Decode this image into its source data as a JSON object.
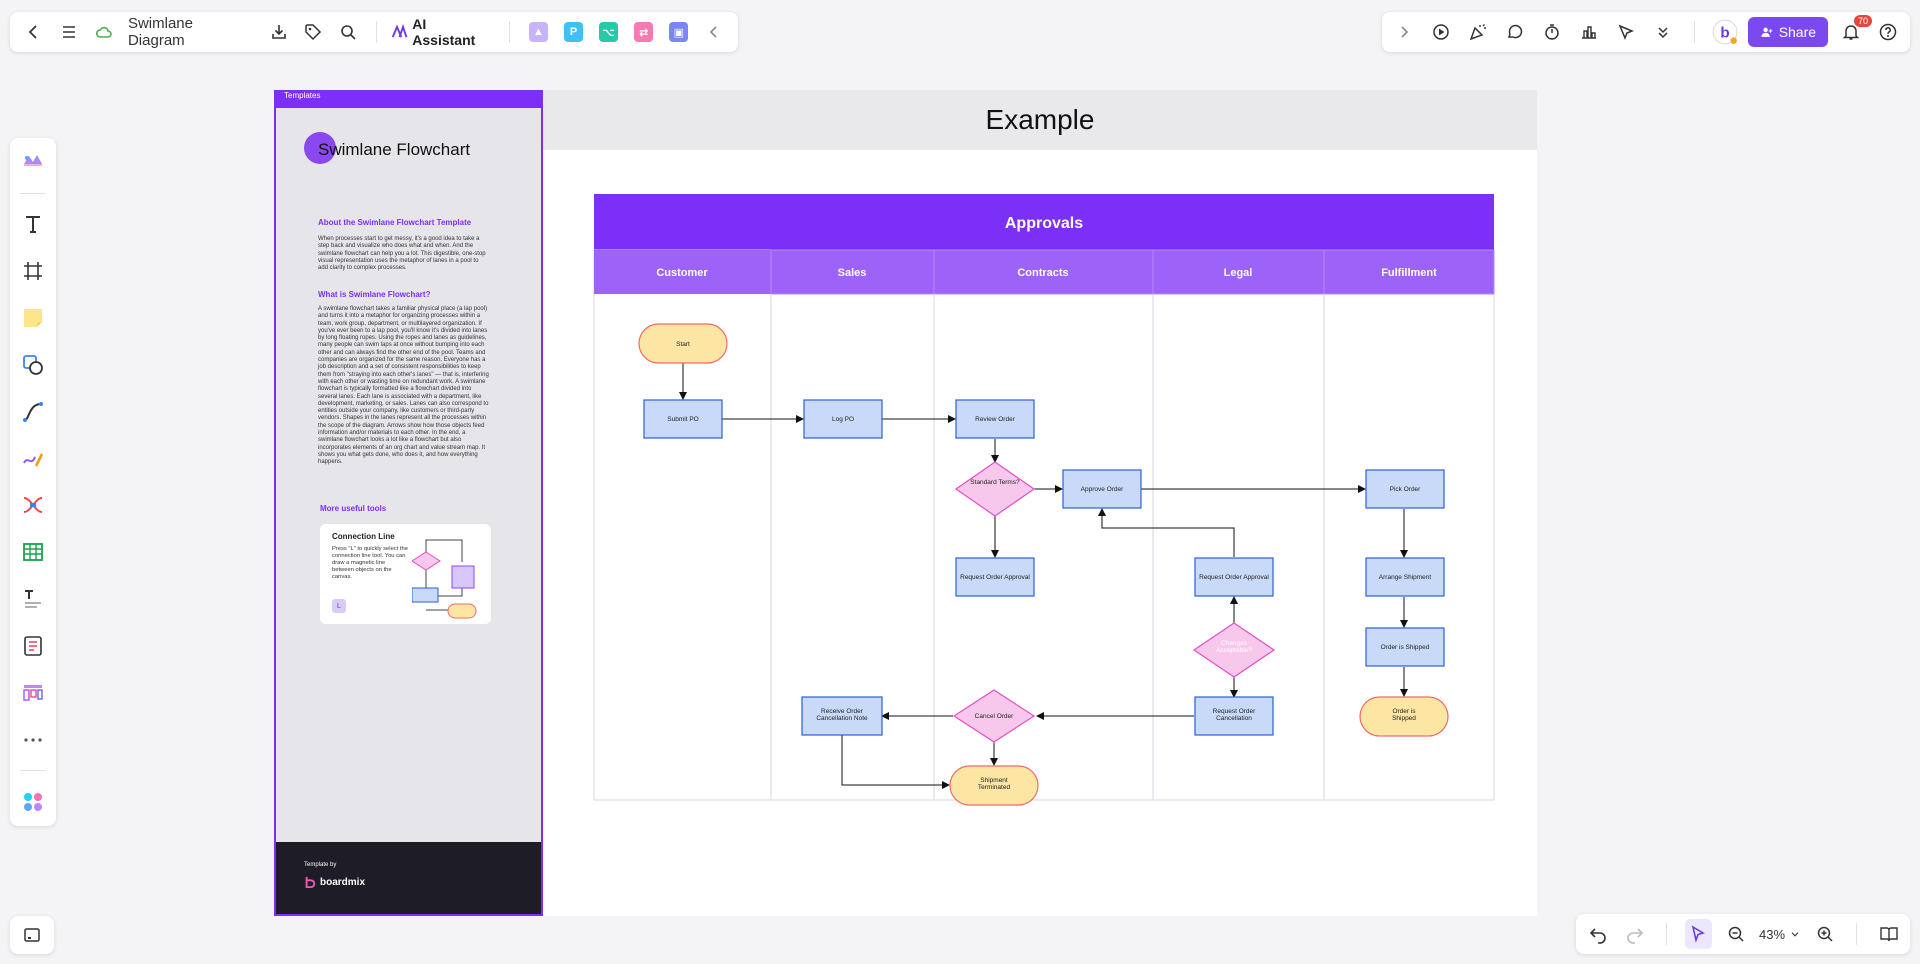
{
  "toolbar": {
    "doc_title": "Swimlane Diagram",
    "ai_label": "AI Assistant",
    "share_label": "Share",
    "notification_count": "70",
    "accent": "#7a4af0"
  },
  "zoom": {
    "level": "43%"
  },
  "template_panel": {
    "tab_label": "Templates",
    "title": "Swimlane Flowchart",
    "about_heading": "About the Swimlane Flowchart Template",
    "about_text": "When processes start to get messy, it's a good idea to take a step back and visualize who does what and when. And the swimlane flowchart can help you a lot. This digestible, one-stop visual representation uses the metaphor of lanes in a pool to add clarity to complex processes.",
    "what_heading": "What is Swimlane Flowchart?",
    "what_text": "A swimlane flowchart takes a familiar physical place (a lap pool) and turns it into a metaphor for organizing processes within a team, work group, department, or multilayered organization. If you've ever been to a lap pool, you'll know it's divided into lanes by long floating ropes. Using the ropes and lanes as guidelines, many people can swim laps at once without bumping into each other and can always find the other end of the pool. Teams and companies are organized for the same reason. Everyone has a job description and a set of consistent responsibilities to keep them from \"straying into each other's lanes\" — that is, interfering with each other or wasting time on redundant work. A swimlane flowchart is typically formatted like a flowchart divided into several lanes. Each lane is associated with a department, like development, marketing, or sales. Lanes can also correspond to entities outside your company, like customers or third-party vendors. Shapes in the lanes represent all the processes within the scope of the diagram. Arrows show how those objects feed information and/or materials to each other. In the end, a swimlane flowchart looks a lot like a flowchart but also incorporates elements of an org chart and value stream map. It shows you what gets done, who does it, and how everything happens.",
    "tools_heading": "More useful tools",
    "card_title": "Connection Line",
    "card_text": "Press \"L\" to quickly select the connection line tool. You can draw a magnetic line between objects on the canvas.",
    "card_key": "L",
    "footer_by": "Template by",
    "footer_brand": "boardmix"
  },
  "board": {
    "heading": "Example",
    "pool_title": "Approvals",
    "lanes": [
      "Customer",
      "Sales",
      "Contracts",
      "Legal",
      "Fulfillment"
    ],
    "colors": {
      "pool": "#7b2ff7",
      "lane_header": "#9d62f8",
      "process": "#c8daf8",
      "process_border": "#2a5fd6",
      "decision": "#f8c8ec",
      "decision_border": "#e24fc5",
      "terminal": "#fde5a3",
      "terminal_border": "#ef6b6b"
    },
    "nodes": {
      "start": "Start",
      "submit_po": "Submit PO",
      "log_po": "Log PO",
      "review_order": "Review Order",
      "standard_terms": "Standard Terms?",
      "approve_order": "Approve Order",
      "pick_order": "Pick Order",
      "request_approval_contracts": "Request Order Approval",
      "request_approval_legal": "Request Order Approval",
      "legal_decision": "Changes Acceptable?",
      "arrange_shipment": "Arrange Shipment",
      "order_shipped_process": "Order is Shipped",
      "order_shipped_terminal": "Order is Shipped",
      "cancel_order": "Cancel Order",
      "request_cancellation": "Request Order Cancellation",
      "receive_cancellation": "Receive Order Cancellation Note",
      "shipment_terminated": "Shipment Terminated"
    }
  }
}
